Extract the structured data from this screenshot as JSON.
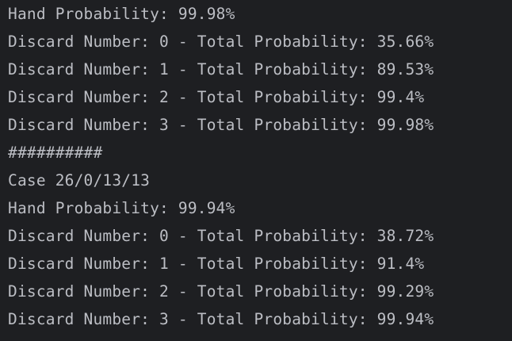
{
  "console": {
    "lines": [
      "Hand Probability: 99.98%",
      "Discard Number: 0 - Total Probability: 35.66%",
      "Discard Number: 1 - Total Probability: 89.53%",
      "Discard Number: 2 - Total Probability: 99.4%",
      "Discard Number: 3 - Total Probability: 99.98%",
      "##########",
      "Case 26/0/13/13",
      "Hand Probability: 99.94%",
      "Discard Number: 0 - Total Probability: 38.72%",
      "Discard Number: 1 - Total Probability: 91.4%",
      "Discard Number: 2 - Total Probability: 99.29%",
      "Discard Number: 3 - Total Probability: 99.94%"
    ]
  },
  "colors": {
    "background": "#1e1f22",
    "text": "#bcbec4"
  }
}
